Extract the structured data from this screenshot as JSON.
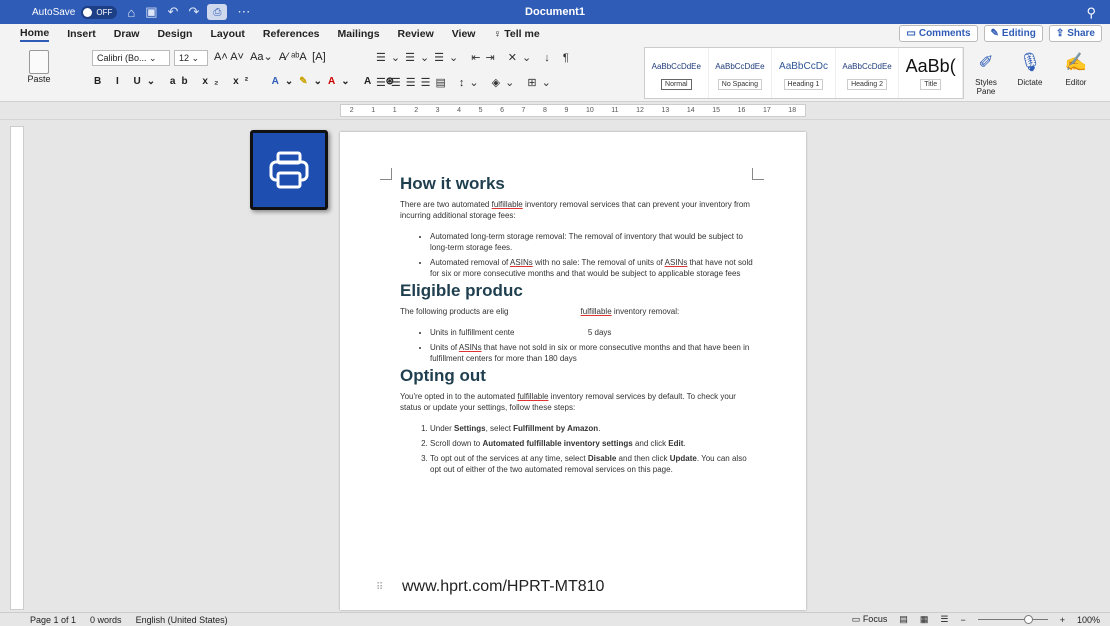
{
  "titlebar": {
    "autosave_label": "AutoSave",
    "autosave_state": "OFF",
    "doc_title": "Document1"
  },
  "menu": {
    "tabs": [
      "Home",
      "Insert",
      "Draw",
      "Design",
      "Layout",
      "References",
      "Mailings",
      "Review",
      "View"
    ],
    "tell_me": "Tell me",
    "comments": "Comments",
    "editing": "Editing",
    "share": "Share"
  },
  "ribbon": {
    "paste": "Paste",
    "font_name": "Calibri (Bo...",
    "font_size": "12",
    "styles": [
      {
        "preview": "AaBbCcDdEe",
        "name": "Normal"
      },
      {
        "preview": "AaBbCcDdEe",
        "name": "No Spacing"
      },
      {
        "preview": "AaBbCcDc",
        "name": "Heading 1"
      },
      {
        "preview": "AaBbCcDdEe",
        "name": "Heading 2"
      },
      {
        "preview": "AaBb(",
        "name": "Title"
      }
    ],
    "styles_pane": "Styles Pane",
    "dictate": "Dictate",
    "editor": "Editor"
  },
  "ruler": {
    "ticks": [
      "2",
      "1",
      "1",
      "2",
      "3",
      "4",
      "5",
      "6",
      "7",
      "8",
      "9",
      "10",
      "11",
      "12",
      "13",
      "14",
      "15",
      "16",
      "17",
      "18"
    ]
  },
  "doc": {
    "h1": "How it works",
    "p1_a": "There are two automated ",
    "p1_u": "fulfillable",
    "p1_b": " inventory removal services that can prevent your inventory from incurring additional storage fees:",
    "b1": "Automated long-term storage removal: The removal of inventory that would be subject to long-term storage fees.",
    "b2_a": "Automated removal of ",
    "b2_u": "ASINs",
    "b2_b": " with no sale: The removal of units of ",
    "b2_u2": "ASINs",
    "b2_c": " that have not sold for six or more consecutive months and that would be subject to applicable storage fees",
    "h2": "Eligible produc",
    "p2_a": "The following products are elig",
    "p2_u": "fulfillable",
    "p2_b": " inventory removal:",
    "b3": "Units in fulfillment cente                                 5 days",
    "b4_a": "Units of ",
    "b4_u": "ASINs",
    "b4_b": " that have not sold in six or more consecutive months and that have been in fulfillment centers for more than 180 days",
    "h3": "Opting out",
    "p3_a": "You're opted in to the automated ",
    "p3_u": "fulfillable",
    "p3_b": " inventory removal services by default. To check your status or update your settings, follow these steps:",
    "s1_a": "Under ",
    "s1_b": "Settings",
    "s1_c": ", select ",
    "s1_d": "Fulfillment by Amazon",
    "s1_e": ".",
    "s2_a": "Scroll down to ",
    "s2_b": "Automated fulfillable inventory settings",
    "s2_c": " and click ",
    "s2_d": "Edit",
    "s2_e": ".",
    "s3_a": "To opt out of the services at any time, select ",
    "s3_b": "Disable",
    "s3_c": " and then click ",
    "s3_d": "Update",
    "s3_e": ". You can also opt out of either of the two automated removal services on this page.",
    "url": "www.hprt.com/HPRT-MT810"
  },
  "status": {
    "page": "Page 1 of 1",
    "words": "0 words",
    "language": "English (United States)",
    "focus": "Focus",
    "zoom": "100%"
  }
}
